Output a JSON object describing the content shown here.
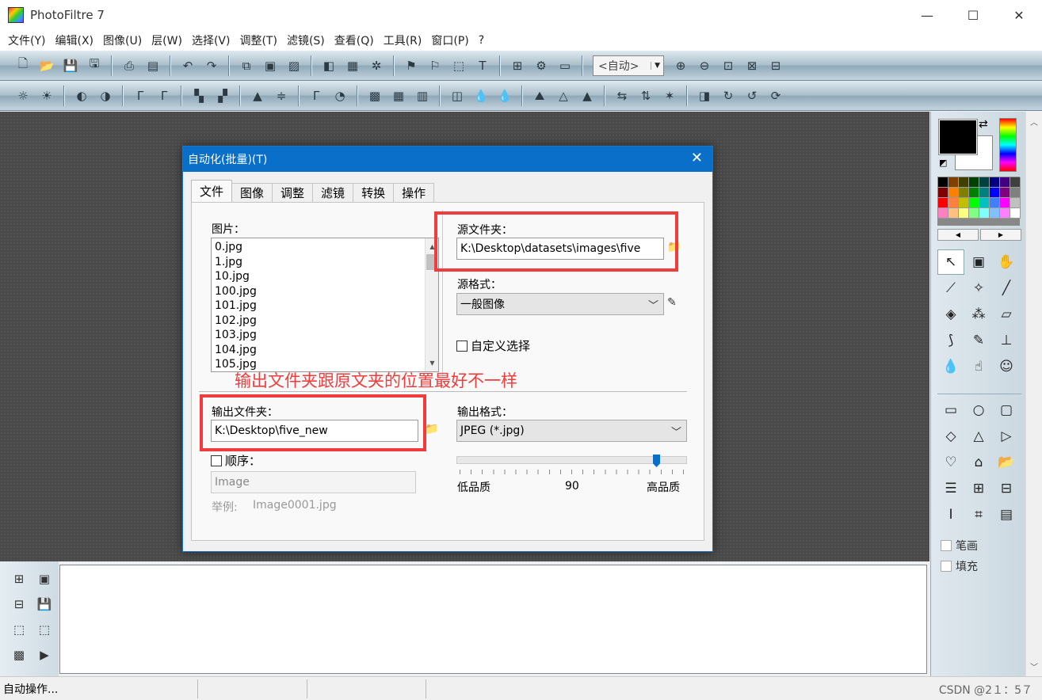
{
  "window": {
    "title": "PhotoFiltre 7",
    "min": "—",
    "max": "☐",
    "close": "✕"
  },
  "menu": [
    "文件(Y)",
    "编辑(X)",
    "图像(U)",
    "层(W)",
    "选择(V)",
    "调整(T)",
    "滤镜(S)",
    "查看(Q)",
    "工具(R)",
    "窗口(P)",
    "?"
  ],
  "toolbar": {
    "zoom_value": "<自动>"
  },
  "dialog": {
    "title": "自动化(批量)(T)",
    "close": "✕",
    "tabs": [
      "文件",
      "图像",
      "调整",
      "滤镜",
      "转换",
      "操作"
    ],
    "pictures_label": "图片：",
    "files": [
      "0.jpg",
      "1.jpg",
      "10.jpg",
      "100.jpg",
      "101.jpg",
      "102.jpg",
      "103.jpg",
      "104.jpg",
      "105.jpg"
    ],
    "source_folder_label": "源文件夹：",
    "source_folder_value": "K:\\Desktop\\datasets\\images\\five",
    "source_format_label": "源格式：",
    "source_format_value": "一般图像",
    "custom_select_label": "自定义选择",
    "output_folder_label": "输出文件夹：",
    "output_folder_value": "K:\\Desktop\\five_new",
    "output_format_label": "输出格式：",
    "output_format_value": "JPEG (*.jpg)",
    "sequence_label": "顺序：",
    "sequence_placeholder": "Image",
    "example_label": "举例:",
    "example_value": "Image0001.jpg",
    "quality_low": "低品质",
    "quality_value": "90",
    "quality_high": "高品质",
    "quality_fraction": 0.88
  },
  "annotation": "输出文件夹跟原文夹的位置最好不一样",
  "panel": {
    "pen_label": "笔画",
    "fill_label": "填充"
  },
  "status": {
    "text": "自动操作...",
    "watermark": "CSDN @2１：5７"
  },
  "colors": {
    "accent": "#0a6fc9",
    "annotation_red": "#f03c3c",
    "palette": [
      "#000000",
      "#804000",
      "#404000",
      "#004000",
      "#004040",
      "#000080",
      "#400080",
      "#404040",
      "#800000",
      "#ff8000",
      "#808000",
      "#008000",
      "#008080",
      "#0000ff",
      "#800080",
      "#808080",
      "#ff0000",
      "#ff8040",
      "#c0c000",
      "#00ff00",
      "#00c0c0",
      "#4080ff",
      "#ff00ff",
      "#c0c0c0",
      "#ff80c0",
      "#ffc080",
      "#ffff80",
      "#80ff80",
      "#80ffff",
      "#80c0ff",
      "#ff80ff",
      "#ffffff"
    ]
  }
}
